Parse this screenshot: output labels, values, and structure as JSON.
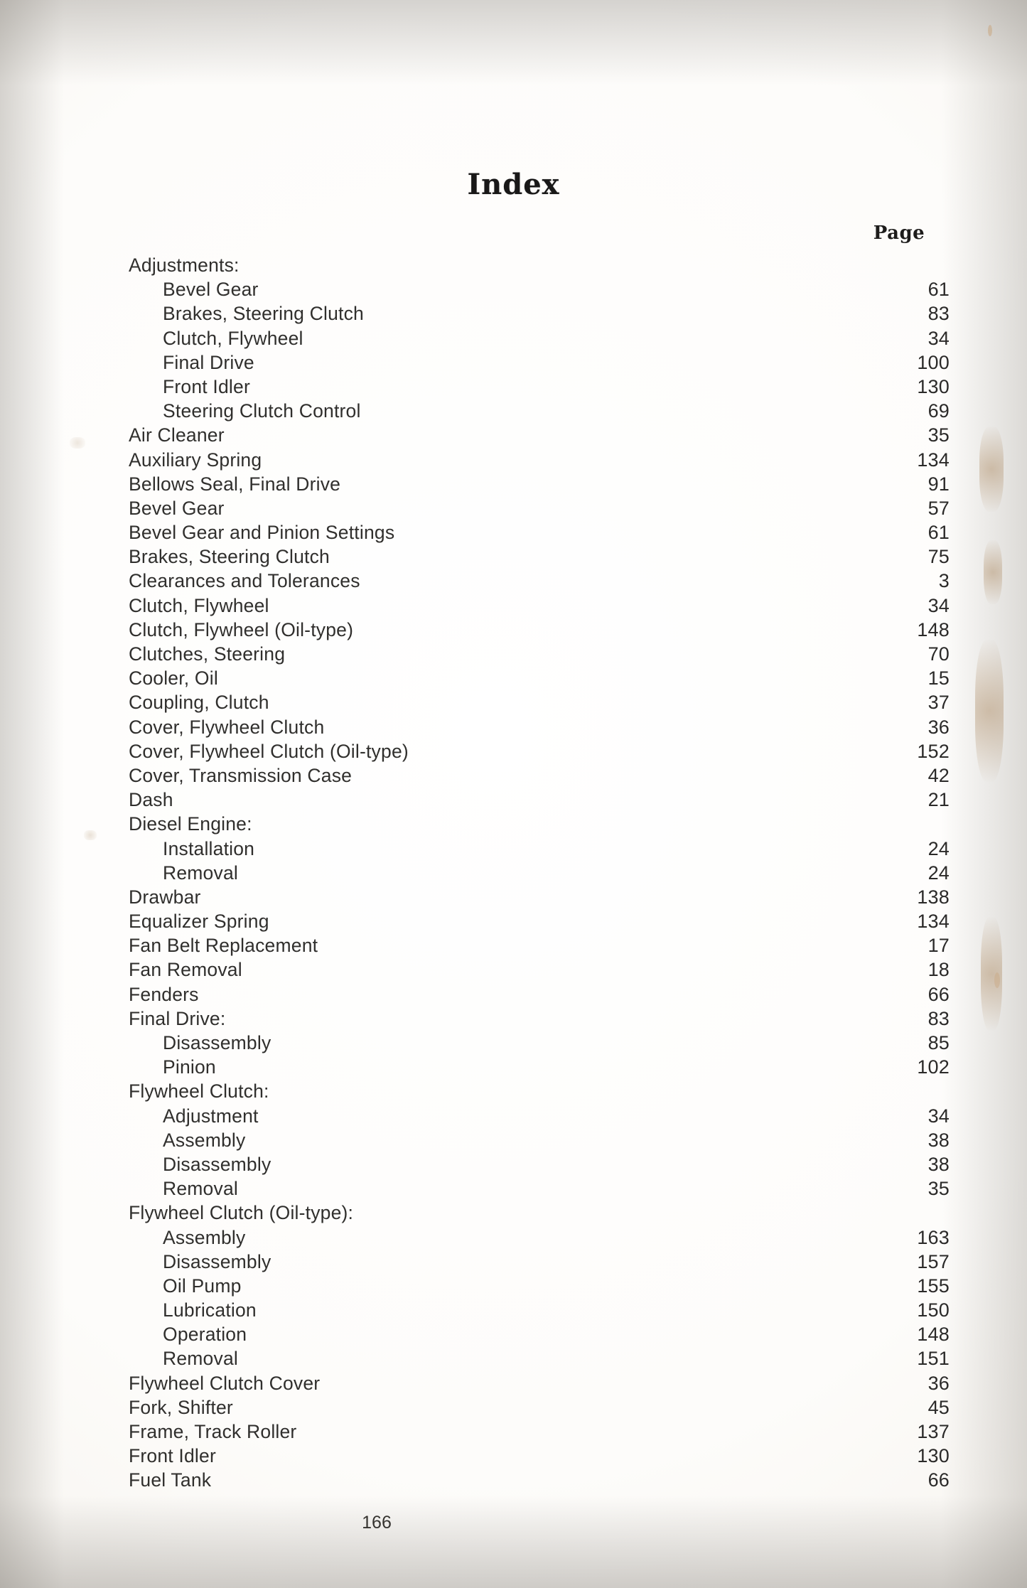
{
  "document": {
    "title": "Index",
    "page_column_header": "Page",
    "folio": "166"
  },
  "entries": [
    {
      "label": "Adjustments:",
      "level": 0,
      "page": "",
      "leader": false
    },
    {
      "label": "Bevel Gear",
      "level": 1,
      "page": "61",
      "leader": true
    },
    {
      "label": "Brakes, Steering Clutch",
      "level": 1,
      "page": "83",
      "leader": true
    },
    {
      "label": "Clutch, Flywheel",
      "level": 1,
      "page": "34",
      "leader": true
    },
    {
      "label": "Final Drive",
      "level": 1,
      "page": "100",
      "leader": true
    },
    {
      "label": "Front Idler",
      "level": 1,
      "page": "130",
      "leader": true
    },
    {
      "label": "Steering Clutch Control",
      "level": 1,
      "page": "69",
      "leader": true
    },
    {
      "label": "Air Cleaner",
      "level": 0,
      "page": "35",
      "leader": true
    },
    {
      "label": "Auxiliary Spring",
      "level": 0,
      "page": "134",
      "leader": true
    },
    {
      "label": "Bellows Seal, Final Drive",
      "level": 0,
      "page": "91",
      "leader": true
    },
    {
      "label": "Bevel Gear",
      "level": 0,
      "page": "57",
      "leader": true
    },
    {
      "label": "Bevel Gear and Pinion Settings",
      "level": 0,
      "page": "61",
      "leader": true
    },
    {
      "label": "Brakes, Steering Clutch",
      "level": 0,
      "page": "75",
      "leader": true
    },
    {
      "label": "Clearances and Tolerances",
      "level": 0,
      "page": "3",
      "leader": true
    },
    {
      "label": "Clutch, Flywheel",
      "level": 0,
      "page": "34",
      "leader": true
    },
    {
      "label": "Clutch, Flywheel (Oil-type)",
      "level": 0,
      "page": "148",
      "leader": true
    },
    {
      "label": "Clutches, Steering",
      "level": 0,
      "page": "70",
      "leader": true
    },
    {
      "label": "Cooler, Oil",
      "level": 0,
      "page": "15",
      "leader": true
    },
    {
      "label": "Coupling, Clutch",
      "level": 0,
      "page": "37",
      "leader": true
    },
    {
      "label": "Cover, Flywheel Clutch",
      "level": 0,
      "page": "36",
      "leader": true
    },
    {
      "label": "Cover, Flywheel Clutch (Oil-type)",
      "level": 0,
      "page": "152",
      "leader": true
    },
    {
      "label": "Cover, Transmission Case",
      "level": 0,
      "page": "42",
      "leader": true
    },
    {
      "label": "Dash",
      "level": 0,
      "page": "21",
      "leader": true
    },
    {
      "label": "Diesel Engine:",
      "level": 0,
      "page": "",
      "leader": false
    },
    {
      "label": "Installation",
      "level": 1,
      "page": "24",
      "leader": true
    },
    {
      "label": "Removal",
      "level": 1,
      "page": "24",
      "leader": true
    },
    {
      "label": "Drawbar",
      "level": 0,
      "page": "138",
      "leader": true
    },
    {
      "label": "Equalizer Spring",
      "level": 0,
      "page": "134",
      "leader": true
    },
    {
      "label": "Fan Belt Replacement",
      "level": 0,
      "page": "17",
      "leader": true
    },
    {
      "label": "Fan Removal",
      "level": 0,
      "page": "18",
      "leader": true
    },
    {
      "label": "Fenders",
      "level": 0,
      "page": "66",
      "leader": true
    },
    {
      "label": "Final Drive:",
      "level": 0,
      "page": "83",
      "leader": true
    },
    {
      "label": "Disassembly",
      "level": 1,
      "page": "85",
      "leader": true
    },
    {
      "label": "Pinion",
      "level": 1,
      "page": "102",
      "leader": true
    },
    {
      "label": "Flywheel Clutch:",
      "level": 0,
      "page": "",
      "leader": false
    },
    {
      "label": "Adjustment",
      "level": 1,
      "page": "34",
      "leader": true
    },
    {
      "label": "Assembly",
      "level": 1,
      "page": "38",
      "leader": true
    },
    {
      "label": "Disassembly",
      "level": 1,
      "page": "38",
      "leader": true
    },
    {
      "label": "Removal",
      "level": 1,
      "page": "35",
      "leader": true
    },
    {
      "label": "Flywheel Clutch (Oil-type):",
      "level": 0,
      "page": "",
      "leader": false
    },
    {
      "label": "Assembly",
      "level": 1,
      "page": "163",
      "leader": true
    },
    {
      "label": "Disassembly",
      "level": 1,
      "page": "157",
      "leader": true
    },
    {
      "label": "Oil Pump",
      "level": 1,
      "page": "155",
      "leader": true
    },
    {
      "label": "Lubrication",
      "level": 1,
      "page": "150",
      "leader": true
    },
    {
      "label": "Operation",
      "level": 1,
      "page": "148",
      "leader": true
    },
    {
      "label": "Removal",
      "level": 1,
      "page": "151",
      "leader": true
    },
    {
      "label": "Flywheel Clutch Cover",
      "level": 0,
      "page": "36",
      "leader": true
    },
    {
      "label": "Fork, Shifter",
      "level": 0,
      "page": "45",
      "leader": true
    },
    {
      "label": "Frame, Track Roller",
      "level": 0,
      "page": "137",
      "leader": true
    },
    {
      "label": "Front Idler",
      "level": 0,
      "page": "130",
      "leader": true
    },
    {
      "label": "Fuel Tank",
      "level": 0,
      "page": "66",
      "leader": true
    }
  ]
}
